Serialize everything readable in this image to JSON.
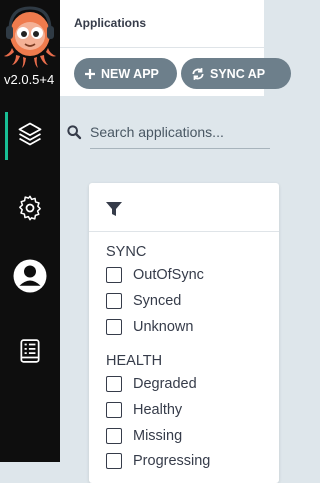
{
  "sidebar": {
    "version": "v2.0.5+4",
    "items": [
      {
        "name": "applications",
        "icon": "layers-icon",
        "active": true
      },
      {
        "name": "settings",
        "icon": "gear-icon",
        "active": false
      },
      {
        "name": "user-info",
        "icon": "user-icon",
        "active": false
      },
      {
        "name": "documentation",
        "icon": "book-icon",
        "active": false
      }
    ],
    "accent": "#18be94"
  },
  "header": {
    "title": "Applications"
  },
  "toolbar": {
    "new_app_label": "NEW APP",
    "sync_apps_label": "SYNC AP"
  },
  "search": {
    "placeholder": "Search applications..."
  },
  "filters": {
    "sync": {
      "title": "SYNC",
      "options": [
        "OutOfSync",
        "Synced",
        "Unknown"
      ]
    },
    "health": {
      "title": "HEALTH",
      "options": [
        "Degraded",
        "Healthy",
        "Missing",
        "Progressing"
      ]
    }
  },
  "colors": {
    "sidebar_bg": "#0e0e0e",
    "button_bg": "#6d7f8b",
    "page_bg": "#dee6eb"
  }
}
